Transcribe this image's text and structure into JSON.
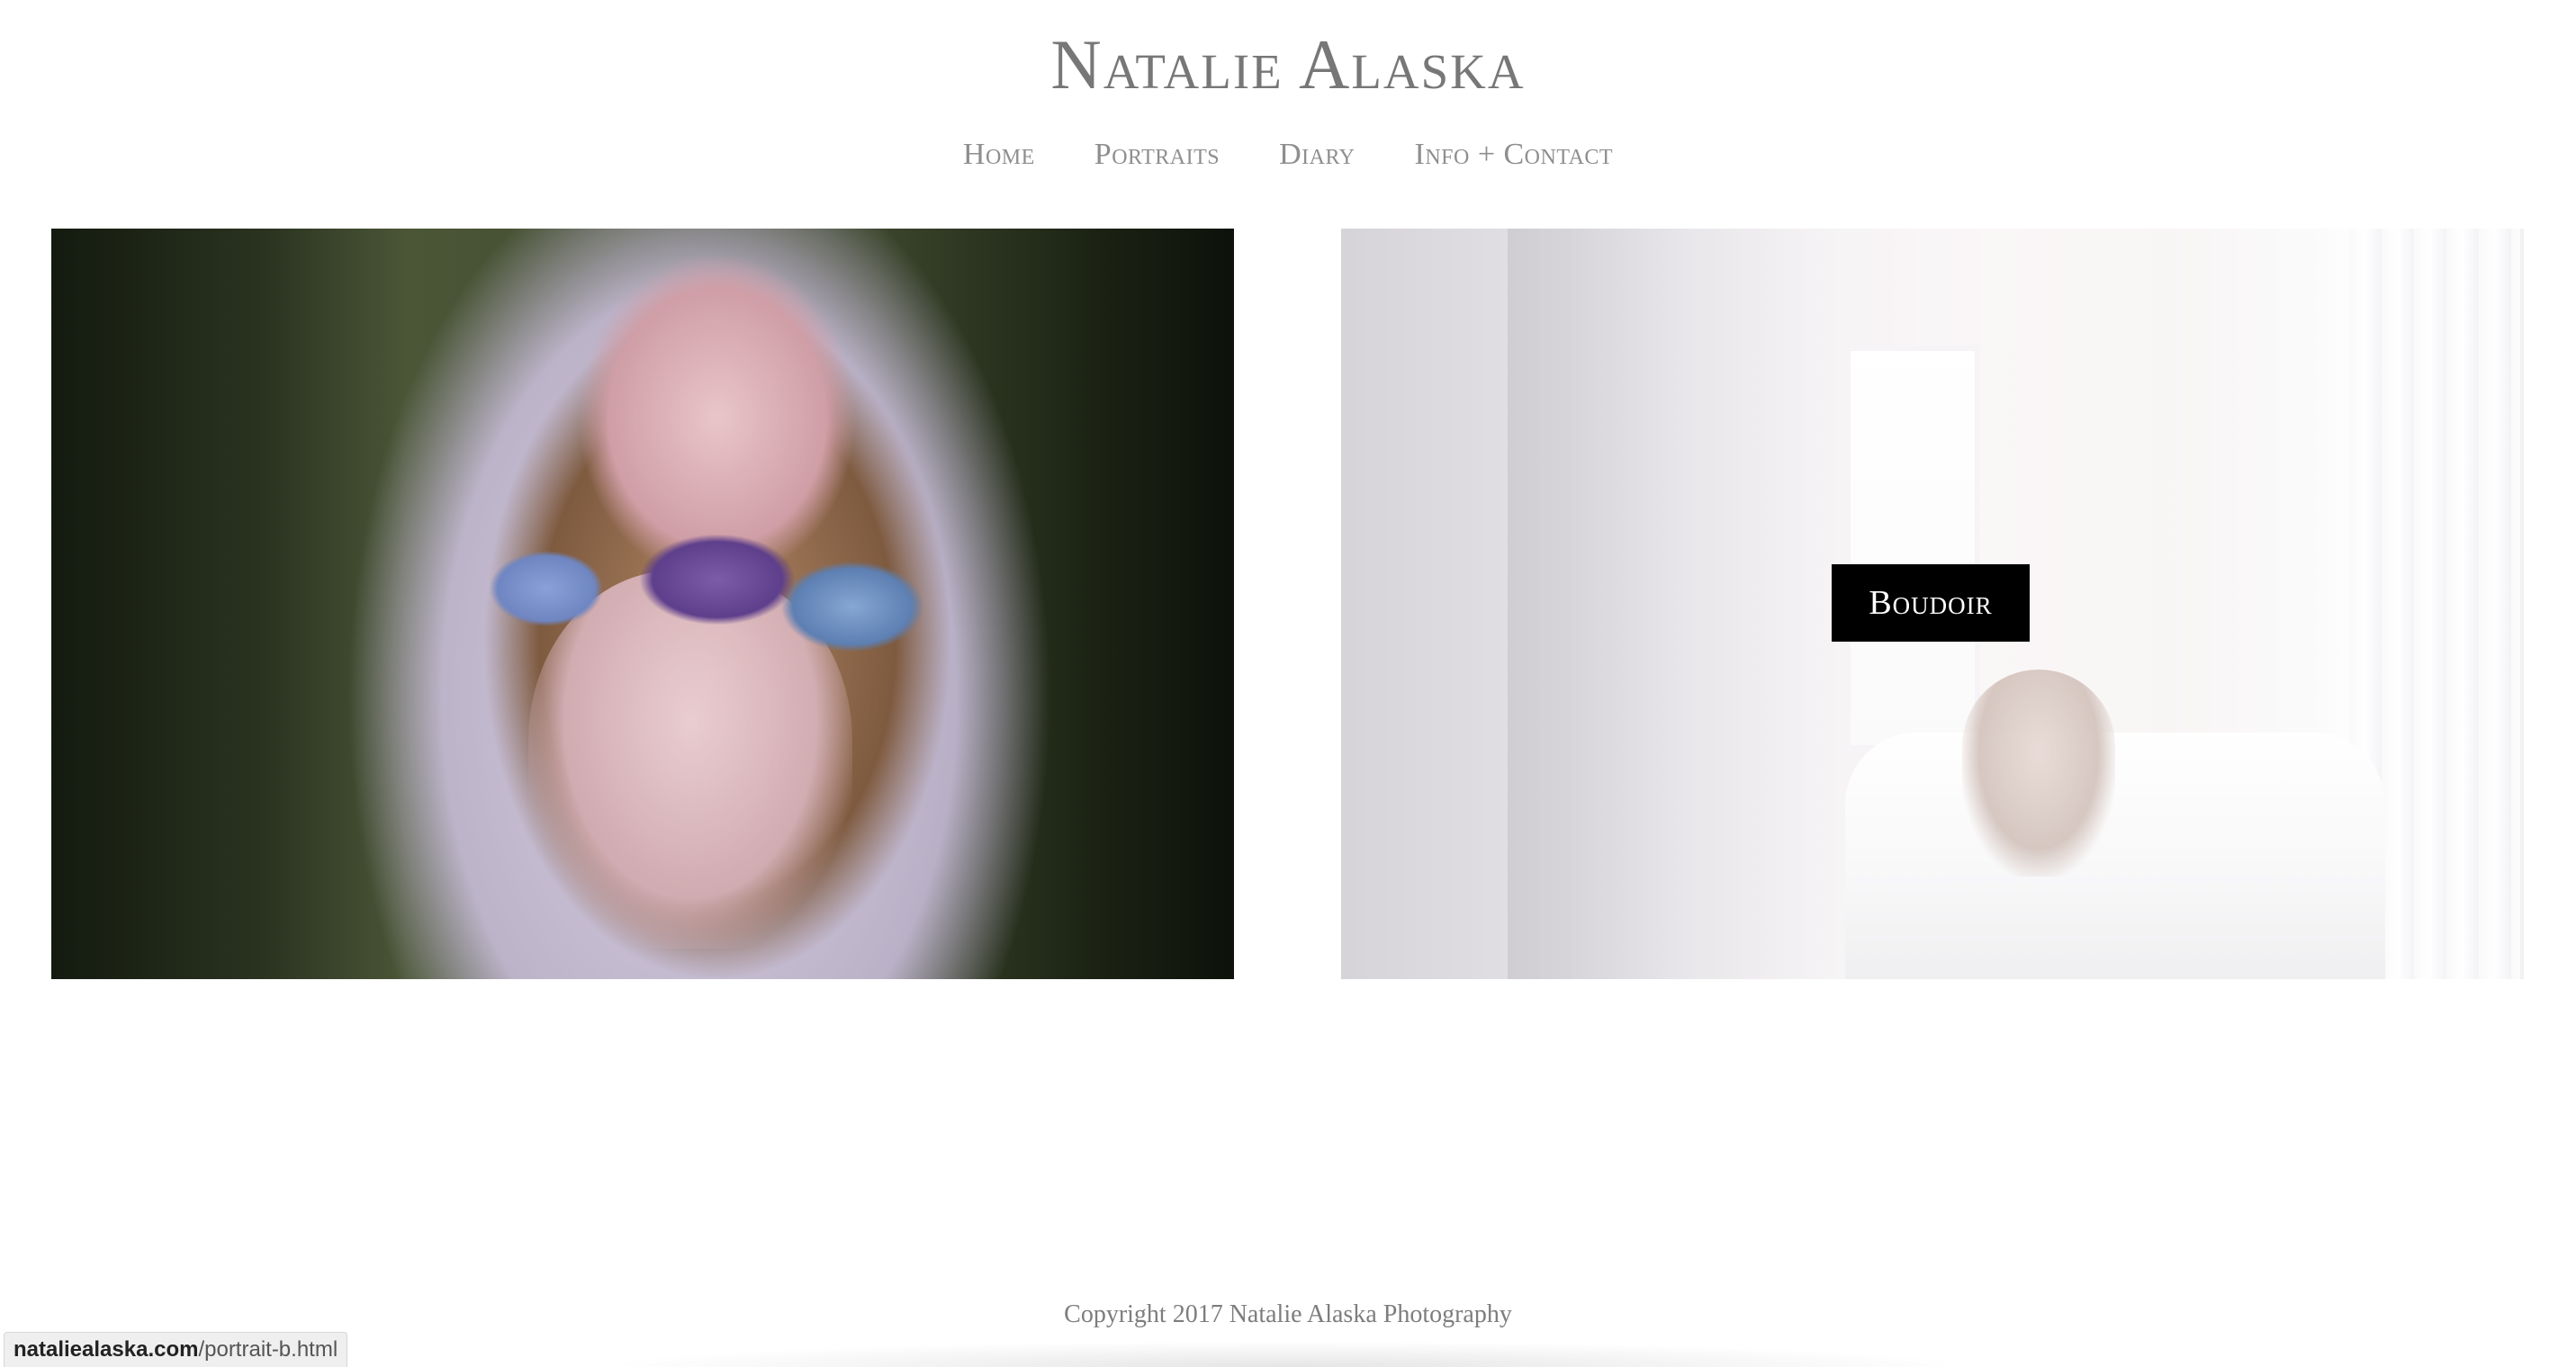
{
  "site": {
    "title": "Natalie Alaska"
  },
  "nav": {
    "items": [
      {
        "label": "Home"
      },
      {
        "label": "Portraits"
      },
      {
        "label": "Diary"
      },
      {
        "label": "Info + Contact"
      }
    ]
  },
  "gallery": {
    "tiles": [
      {
        "caption": ""
      },
      {
        "caption": "Boudoir"
      }
    ]
  },
  "footer": {
    "copyright": "Copyright 2017 Natalie Alaska Photography"
  },
  "status_bar": {
    "host": "nataliealaska.com",
    "path": "/portrait-b.html"
  },
  "colors": {
    "title_text": "#777777",
    "nav_text": "#8e8e8e",
    "caption_bg": "#000000",
    "caption_text": "#ffffff"
  }
}
